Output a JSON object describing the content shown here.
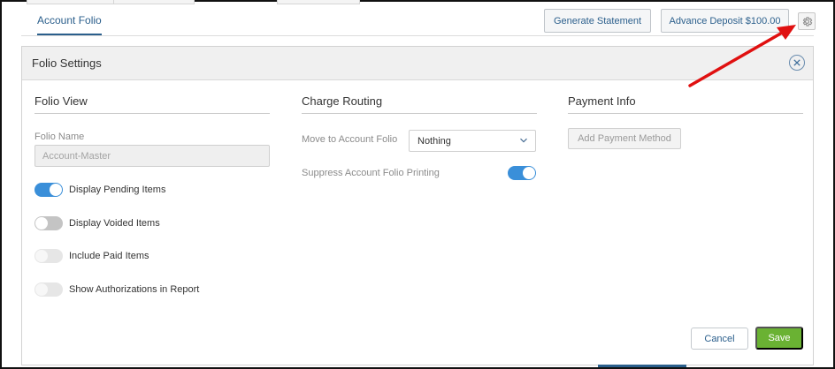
{
  "header": {
    "active_tab": "Account Folio",
    "generate_statement": "Generate Statement",
    "advance_deposit": "Advance Deposit $100.00",
    "settings_icon": "gear-icon"
  },
  "panel": {
    "title": "Folio Settings",
    "close_icon": "close-icon",
    "folio_view": {
      "heading": "Folio View",
      "name_label": "Folio Name",
      "name_value": "Account-Master",
      "toggles": [
        {
          "label": "Display Pending Items",
          "state": "on"
        },
        {
          "label": "Display Voided Items",
          "state": "off"
        },
        {
          "label": "Include Paid Items",
          "state": "off-disabled"
        },
        {
          "label": "Show Authorizations in Report",
          "state": "off-disabled"
        }
      ]
    },
    "charge_routing": {
      "heading": "Charge Routing",
      "move_label": "Move to Account Folio",
      "move_value": "Nothing",
      "suppress_label": "Suppress Account Folio Printing",
      "suppress_state": "on"
    },
    "payment_info": {
      "heading": "Payment Info",
      "add_method": "Add Payment Method"
    },
    "actions": {
      "cancel": "Cancel",
      "save": "Save"
    }
  },
  "colors": {
    "accent": "#2b5f8c",
    "toggle_on": "#3a8fd9",
    "save": "#6ab233",
    "annotation_arrow": "#e01010"
  }
}
